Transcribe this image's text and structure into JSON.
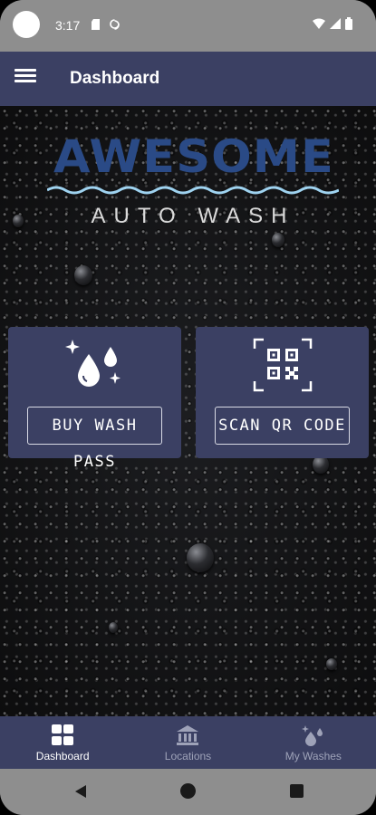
{
  "status_bar": {
    "time": "3:17",
    "icons": [
      "sd-card-icon",
      "sync-icon",
      "wifi-icon",
      "signal-icon",
      "battery-icon"
    ]
  },
  "app_bar": {
    "title": "Dashboard",
    "menu_icon": "hamburger-menu-icon"
  },
  "logo": {
    "word": "AWESOME",
    "tagline": "AUTO WASH",
    "word_color": "#2a4a86",
    "wave_color": "#9fd3f0"
  },
  "cards": [
    {
      "icon": "water-drops-sparkle-icon",
      "button_label": "BUY WASH PASS"
    },
    {
      "icon": "qr-code-icon",
      "button_label": "SCAN QR CODE"
    }
  ],
  "bottom_nav": {
    "items": [
      {
        "label": "Dashboard",
        "icon": "dashboard-grid-icon",
        "active": true
      },
      {
        "label": "Locations",
        "icon": "bank-building-icon",
        "active": false
      },
      {
        "label": "My Washes",
        "icon": "drops-sparkle-icon",
        "active": false
      }
    ]
  },
  "colors": {
    "primary": "#3b4063",
    "system_bar": "#8e8e8e",
    "nav_inactive": "#9ea2b8"
  }
}
